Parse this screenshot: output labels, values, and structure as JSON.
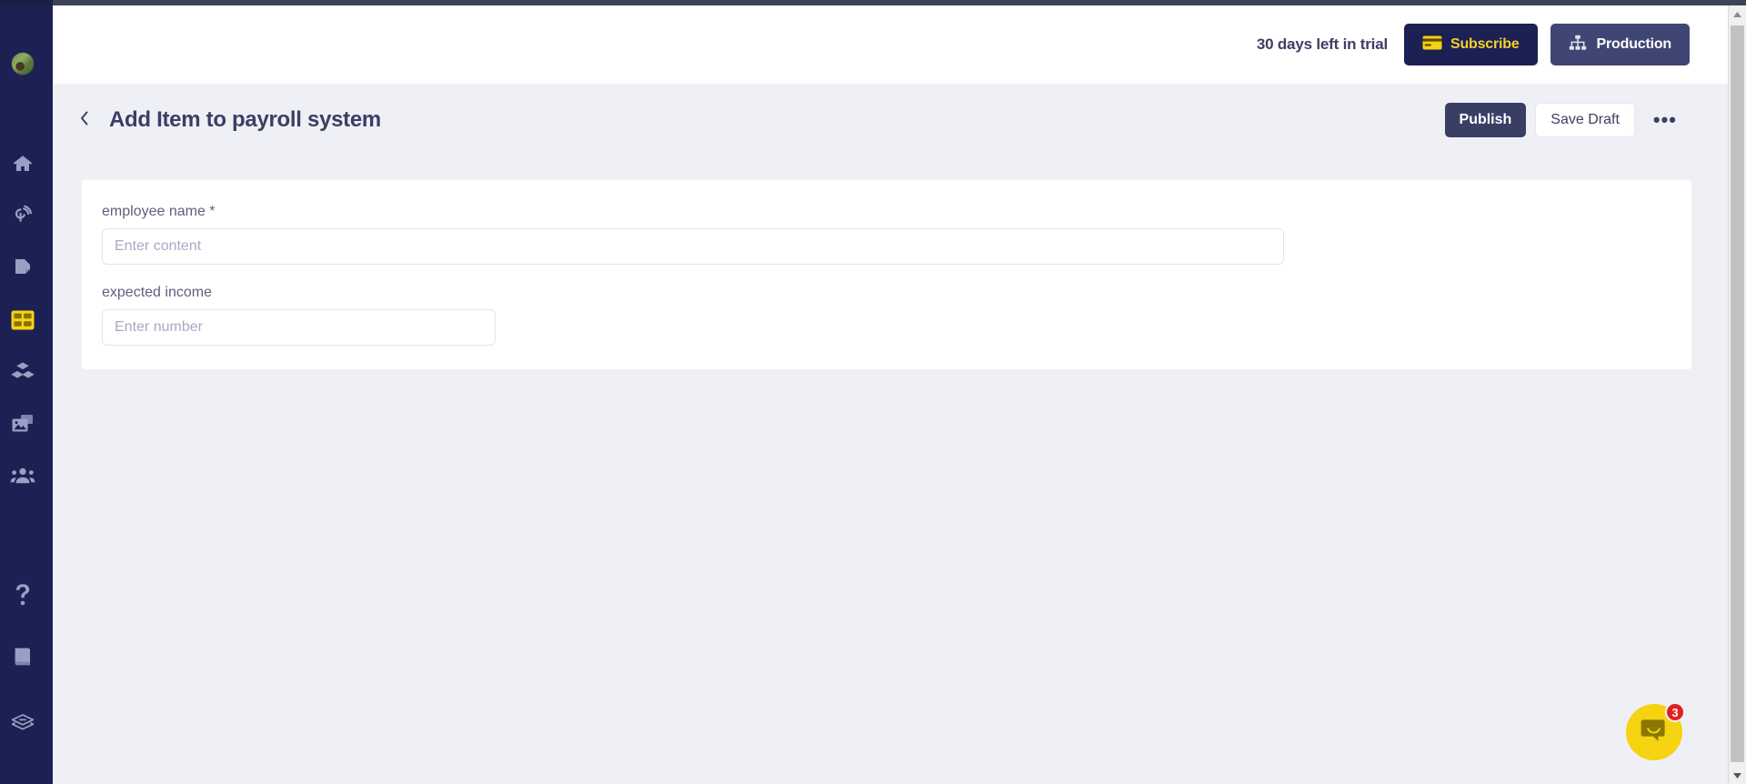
{
  "sidebar": {
    "avatar_label": "user-avatar",
    "items": [
      {
        "icon": "home-icon",
        "name": "home",
        "active": false
      },
      {
        "icon": "broadcast-icon",
        "name": "broadcast",
        "active": false
      },
      {
        "icon": "page-icon",
        "name": "pages",
        "active": false
      },
      {
        "icon": "table-grid-icon",
        "name": "collections",
        "active": true
      },
      {
        "icon": "blocks-icon",
        "name": "components",
        "active": false
      },
      {
        "icon": "media-icon",
        "name": "media",
        "active": false
      },
      {
        "icon": "users-icon",
        "name": "users",
        "active": false
      },
      {
        "icon": "help-question-icon",
        "name": "help",
        "active": false
      },
      {
        "icon": "book-icon",
        "name": "docs",
        "active": false
      },
      {
        "icon": "layers-icon",
        "name": "layers",
        "active": false
      }
    ]
  },
  "topbar": {
    "trial_text": "30 days left in trial",
    "subscribe_label": "Subscribe",
    "subscribe_icon": "credit-card-icon",
    "subscribe_bg": "#1b2153",
    "subscribe_color": "#f7cf2e",
    "production_label": "Production",
    "production_icon": "sitemap-icon",
    "production_bg": "#3f4673"
  },
  "page_head": {
    "back_icon": "chevron-left-icon",
    "title": "Add Item to payroll system",
    "publish_label": "Publish",
    "save_draft_label": "Save Draft",
    "more_label": "•••"
  },
  "form": {
    "fields": [
      {
        "label": "employee name",
        "required_marker": "*",
        "placeholder": "Enter content",
        "value": "",
        "type": "text",
        "width": "wide"
      },
      {
        "label": "expected income",
        "required_marker": "",
        "placeholder": "Enter number",
        "value": "",
        "type": "number",
        "width": "narrow"
      }
    ]
  },
  "intercom": {
    "icon": "chat-bubble-icon",
    "badge_count": "3",
    "bg_color": "#f5d311",
    "badge_color": "#e02020"
  },
  "scrollbar": {
    "up_icon": "scroll-up-arrow-icon",
    "down_icon": "scroll-down-arrow-icon"
  }
}
